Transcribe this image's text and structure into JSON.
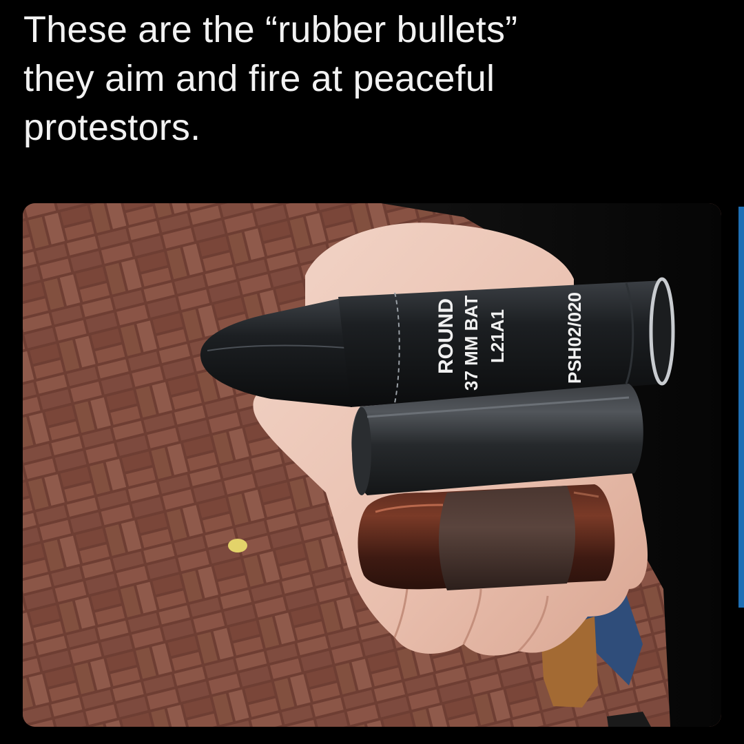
{
  "post": {
    "caption_lines": [
      "These are the “rubber bullets”",
      "they aim and fire at peaceful",
      "protestors."
    ]
  },
  "photo": {
    "casing_label": {
      "line1": "ROUND",
      "line2": "37 MM BAT",
      "line3": "L21A1",
      "lot": "PSH02/020"
    }
  },
  "colors": {
    "background": "#000000",
    "caption_text": "#f2f2f2",
    "accent_bar": "#1e6fb5"
  }
}
